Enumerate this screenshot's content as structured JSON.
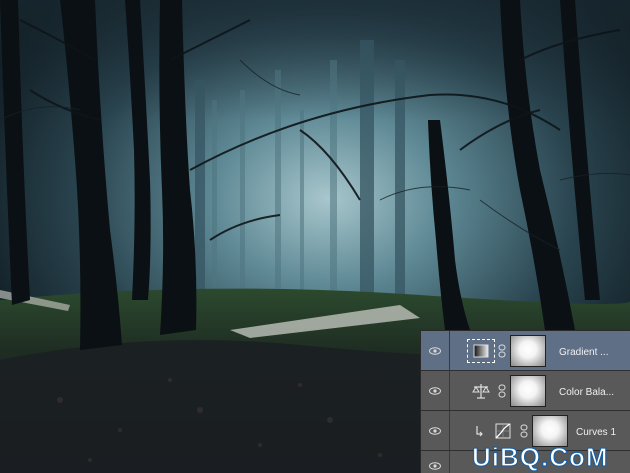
{
  "layers": [
    {
      "name": "Gradient ...",
      "icon": "gradient-map-icon",
      "selected": true,
      "clipped": false
    },
    {
      "name": "Color Bala...",
      "icon": "color-balance-icon",
      "selected": false,
      "clipped": false
    },
    {
      "name": "Curves 1",
      "icon": "curves-icon",
      "selected": false,
      "clipped": true
    },
    {
      "name": "",
      "icon": "",
      "selected": false,
      "clipped": false
    }
  ],
  "watermark": {
    "text": "UiBQ.CoM"
  },
  "colors": {
    "panel": "#4b4b4b",
    "selected_row": "#5f6f85",
    "row": "#595959"
  }
}
